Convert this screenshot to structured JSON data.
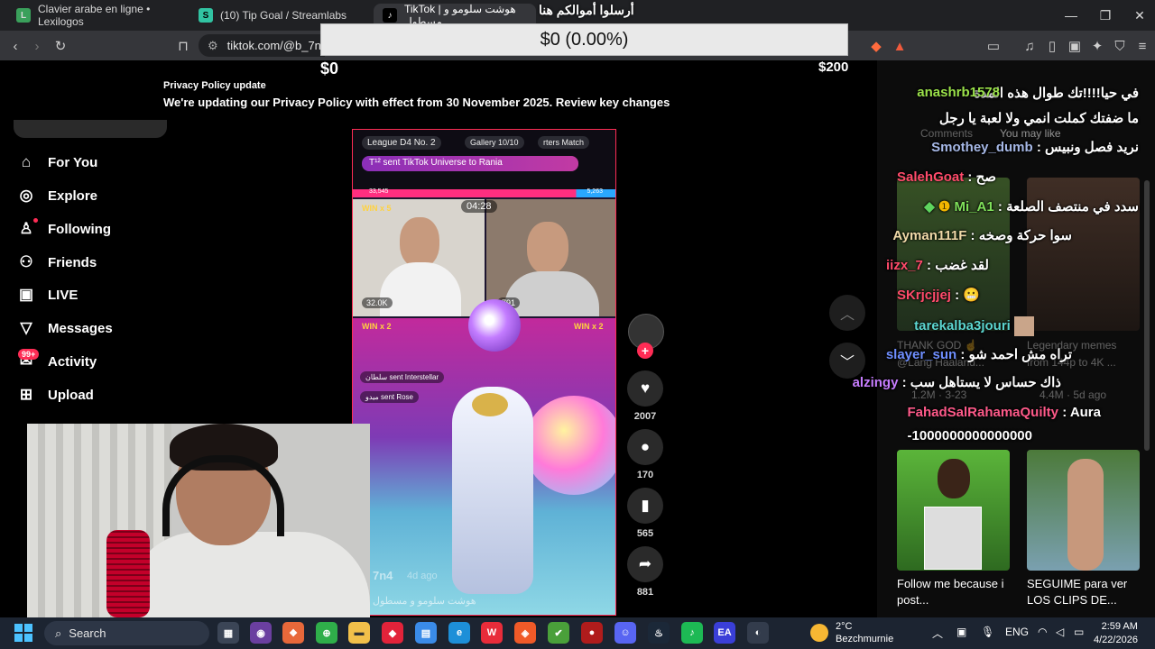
{
  "browser": {
    "tabs": [
      {
        "label": "Clavier arabe en ligne • Lexilogos",
        "icon_color": "#3aa05b",
        "icon_letter": "L"
      },
      {
        "label": "(10) Tip Goal / Streamlabs",
        "icon_color": "#31c3a2",
        "icon_letter": "S"
      },
      {
        "label": "TikTok | هوشت سلومو و مسطول",
        "icon_color": "#000000",
        "icon_letter": "♪"
      }
    ],
    "url": "tiktok.com/@b_7n4"
  },
  "goal": {
    "title": "أرسلوا أموالكم هنا",
    "progress_text": "$0 (0.00%)",
    "progress_fraction": 0.0,
    "min_label": "$0",
    "max_label": "$200"
  },
  "privacy": {
    "title": "Privacy Policy update",
    "text": "We're updating our Privacy Policy with effect from 30 November 2025. Review key changes"
  },
  "sidebar": {
    "items": [
      {
        "label": "For You",
        "icon": "home-icon"
      },
      {
        "label": "Explore",
        "icon": "compass-icon"
      },
      {
        "label": "Following",
        "icon": "following-icon"
      },
      {
        "label": "Friends",
        "icon": "friends-icon"
      },
      {
        "label": "LIVE",
        "icon": "live-icon"
      },
      {
        "label": "Messages",
        "icon": "messages-icon"
      },
      {
        "label": "Activity",
        "icon": "activity-icon"
      },
      {
        "label": "Upload",
        "icon": "upload-icon"
      }
    ],
    "activity_badge": "99+"
  },
  "video": {
    "league": "League D4 No. 2",
    "gallery": "Gallery",
    "gallery_count": "10/10",
    "match": "rters   Match",
    "gift_text": "T¹² sent TikTok Universe to Rania",
    "score_left": "33,545",
    "score_right": "5,263",
    "timer": "04:28",
    "win_left_top": "WIN x 5",
    "win_left_bottom": "WIN x 2",
    "win_right_bottom": "WIN x 2",
    "count_left": "32.0K",
    "count_right": "791",
    "chip_1": "سلطان sent Interstellar",
    "chip_2": "ميدو sent Rose",
    "user": "7n4",
    "date": "4d ago",
    "caption": "هوشت سلومو و مسطول"
  },
  "actions": {
    "likes": "2007",
    "comments": "170",
    "saves": "565",
    "shares": "881"
  },
  "right_panel": {
    "ghost_tabs": [
      "Comments",
      "You may like"
    ],
    "ghost_1": "THANK GOD ☝",
    "ghost_2": "Legendary memes",
    "ghost_3": "@Lang Haaland...",
    "ghost_4": "from 144p to 4K ...",
    "ghost_5": "1.2M · 3-23",
    "ghost_6": "4.4M · 5d ago",
    "card_1": "Follow me because i post...",
    "card_2": "SEGUIME para ver LOS CLIPS DE..."
  },
  "chat": [
    {
      "user": "",
      "text": "في حيا!!!!تك طوال هذه المدة",
      "color": "#ffffff"
    },
    {
      "user": "anashrb1578",
      "text": "",
      "color": "#9be24a"
    },
    {
      "user": "",
      "text": "ما ضفتك كملت انمي ولا لعبة يا رجل",
      "color": "#ffffff"
    },
    {
      "user": "Smothey_dumb",
      "text": "نريد فصل ونبيس",
      "color": "#a6b8e6"
    },
    {
      "user": "SalehGoat",
      "text": "صح",
      "color": "#ff4b6b"
    },
    {
      "user": "Mi_A1",
      "text": "سدد في منتصف الصلعة",
      "color": "#7fe05a"
    },
    {
      "user": "Ayman111F",
      "text": "سوا حركة وصخه",
      "color": "#f0d9a8"
    },
    {
      "user": "iizx_7",
      "text": "لقد غضب",
      "color": "#ff4b6b"
    },
    {
      "user": "SKrjcjjej",
      "text": "😬",
      "color": "#ff4b6b"
    },
    {
      "user": "tarekalba3jouri",
      "text": "",
      "color": "#5cd6d0"
    },
    {
      "user": "slayer_sun",
      "text": "تراه مش احمد شو",
      "color": "#6f8fff"
    },
    {
      "user": "alzingy",
      "text": "ذاك حساس لا يستاهل سب",
      "color": "#c77dff"
    },
    {
      "user": "FahadSalRahamaQuilty",
      "text": "Aura",
      "color": "#ff5a8a"
    },
    {
      "user": "",
      "text": "-1000000000000000",
      "color": "#ffffff"
    }
  ],
  "taskbar": {
    "search_label": "Search",
    "weather_temp": "2°C",
    "weather_place": "Bezchmurnie",
    "lang": "ENG",
    "time": "2:59 AM",
    "date": "4/22/2026"
  }
}
